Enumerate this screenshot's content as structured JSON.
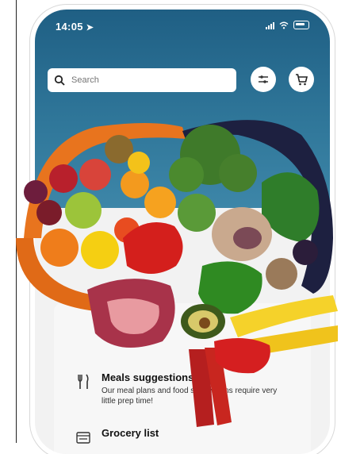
{
  "status_bar": {
    "time": "14:05"
  },
  "search": {
    "placeholder": "Search"
  },
  "features": [
    {
      "title": "Meals suggestions",
      "description": "Our meal plans and food suggestions require very little prep time!"
    },
    {
      "title": "Grocery list",
      "description": ""
    }
  ],
  "colors": {
    "header": "#2a6d90",
    "card": "#f7f7f7"
  },
  "icons": [
    "location-arrow-icon",
    "signal-icon",
    "wifi-icon",
    "battery-icon",
    "search-icon",
    "filter-icon",
    "cart-icon",
    "meals-icon",
    "grocery-list-icon"
  ]
}
